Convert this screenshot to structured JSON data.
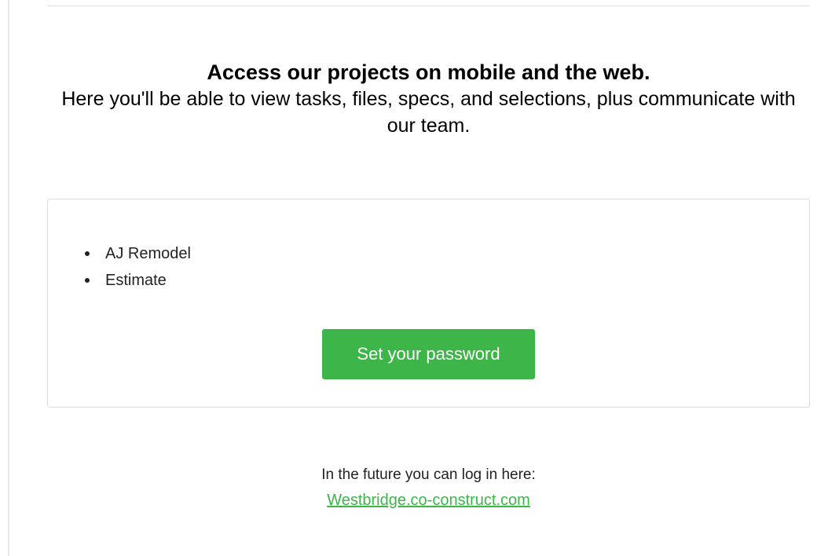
{
  "header": {
    "title": "Access our projects on mobile and the web.",
    "subtitle": "Here you'll be able to view tasks, files, specs, and selections, plus communicate with our team."
  },
  "projects": {
    "items": [
      {
        "label": "AJ Remodel"
      },
      {
        "label": "Estimate"
      }
    ]
  },
  "cta": {
    "label": "Set your password"
  },
  "footer": {
    "note": "In the future you can log in here:",
    "link_text": "Westbridge.co-construct.com"
  },
  "colors": {
    "accent": "#3db549",
    "border": "#dcdcdc"
  }
}
